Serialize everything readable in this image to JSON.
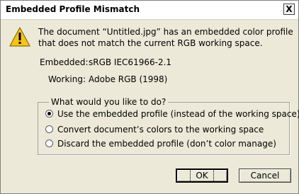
{
  "window": {
    "title": "Embedded Profile Mismatch",
    "close_label": "X"
  },
  "message": {
    "text": "The document “Untitled.jpg” has an embedded color profile that does not match the current RGB working space."
  },
  "embedded": {
    "label": "Embedded:",
    "value": "sRGB IEC61966-2.1"
  },
  "working": {
    "label": "Working:",
    "value": "Adobe RGB (1998)"
  },
  "options": {
    "legend": "What would you like to do?",
    "items": [
      {
        "label": "Use the embedded profile (instead of the working space)",
        "checked": true
      },
      {
        "label": "Convert document’s colors to the working space",
        "checked": false
      },
      {
        "label": "Discard the embedded profile (don’t color manage)",
        "checked": false
      }
    ]
  },
  "buttons": {
    "ok_label": "OK",
    "cancel_label": "Cancel"
  },
  "colors": {
    "dialog_bg": "#ece9d8",
    "warning_yellow": "#f5c518"
  }
}
